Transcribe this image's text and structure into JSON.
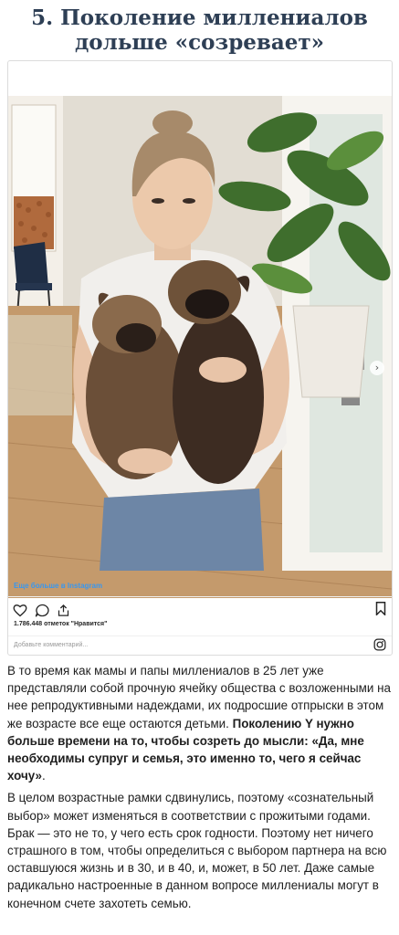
{
  "heading": {
    "line1": "5. Поколение миллениалов",
    "line2": "дольше «созревает»"
  },
  "instagram": {
    "more_link": "Еще больше в Instagram",
    "likes": "1.786.448 отметок \"Нравится\"",
    "comment_placeholder": "Добавьте комментарий...",
    "icons": [
      "heart-icon",
      "comment-icon",
      "share-icon",
      "bookmark-icon",
      "instagram-icon",
      "chevron-right-icon"
    ]
  },
  "article": {
    "p1_plain": "В то время как мамы и папы миллениалов в 25 лет уже представляли собой прочную ячейку общества с возложенными на нее репродуктивными надеждами, их подросшие отпрыски в этом же возрасте все еще остаются детьми. ",
    "p1_bold": "Поколению Y нужно больше времени на то, чтобы созреть до мысли: «Да, мне необходимы супруг и семья, это именно то, чего я сейчас хочу»",
    "p1_end": ".",
    "p2": "В целом возрастные рамки сдвинулись, поэтому «сознательный выбор» может изменяться в соответствии с прожитыми годами. Брак — это не то, у чего есть срок годности. Поэтому нет ничего страшного в том, чтобы определиться с выбором партнера на всю оставшуюся жизнь и в 30, и в 40, и, может, в 50 лет. Даже самые радикально настроенные в данном вопросе миллениалы могут в конечном счете захотеть семью."
  },
  "colors": {
    "heading": "#2e3f55",
    "link": "#3897f0",
    "border": "#dbdbdb"
  }
}
